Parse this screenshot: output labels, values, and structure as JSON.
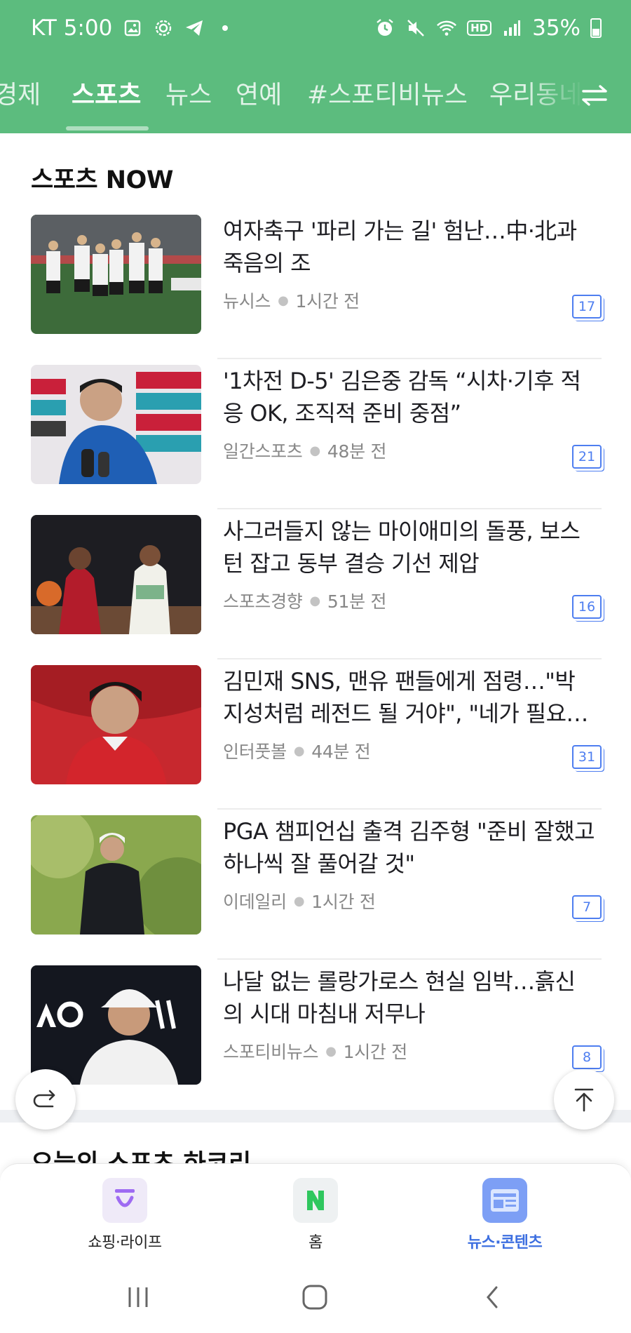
{
  "status_bar": {
    "carrier_time": "KT 5:00",
    "battery": "35%"
  },
  "tabs": [
    {
      "label": "경제",
      "active": false
    },
    {
      "label": "스포츠",
      "active": true
    },
    {
      "label": "뉴스",
      "active": false
    },
    {
      "label": "연예",
      "active": false
    },
    {
      "label": "#스포티비뉴스",
      "active": false
    },
    {
      "label": "우리동네",
      "active": false
    }
  ],
  "section": {
    "title": "스포츠 NOW",
    "items": [
      {
        "headline": "여자축구 '파리 가는 길' 험난…中·北과 죽음의 조",
        "source": "뉴시스",
        "time": "1시간 전",
        "comments": "17",
        "thumb_icon": "women-football-team-photo"
      },
      {
        "headline": "'1차전 D-5' 김은중 감독 “시차·기후 적응 OK, 조직적 준비 중점”",
        "source": "일간스포츠",
        "time": "48분 전",
        "comments": "21",
        "thumb_icon": "coach-interview-photo"
      },
      {
        "headline": "사그러들지 않는 마이애미의 돌풍, 보스턴 잡고 동부 결승 기선 제압",
        "source": "스포츠경향",
        "time": "51분 전",
        "comments": "16",
        "thumb_icon": "basketball-game-photo"
      },
      {
        "headline": "김민재 SNS, 맨유 팬들에게 점령…\"박지성처럼 레전드 될 거야\", \"네가 필요…",
        "source": "인터풋볼",
        "time": "44분 전",
        "comments": "31",
        "thumb_icon": "football-player-photo"
      },
      {
        "headline": "PGA 챔피언십 출격 김주형 \"준비 잘했고 하나씩 잘 풀어갈 것\"",
        "source": "이데일리",
        "time": "1시간 전",
        "comments": "7",
        "thumb_icon": "golfer-photo"
      },
      {
        "headline": "나달 없는 롤랑가로스 현실 임박…흙신의 시대 마침내 저무나",
        "source": "스포티비뉴스",
        "time": "1시간 전",
        "comments": "8",
        "thumb_icon": "tennis-player-photo"
      }
    ]
  },
  "next_section_title": "오늘의 스포츠 하코리",
  "bottom_nav": [
    {
      "label": "쇼핑·라이프",
      "icon": "shopping-bag-icon",
      "active": false
    },
    {
      "label": "홈",
      "icon": "naver-n-icon",
      "active": false
    },
    {
      "label": "뉴스·콘텐츠",
      "icon": "news-content-icon",
      "active": true
    }
  ],
  "colors": {
    "header_green": "#5cbc7e",
    "accent_blue": "#4e7ef0"
  }
}
